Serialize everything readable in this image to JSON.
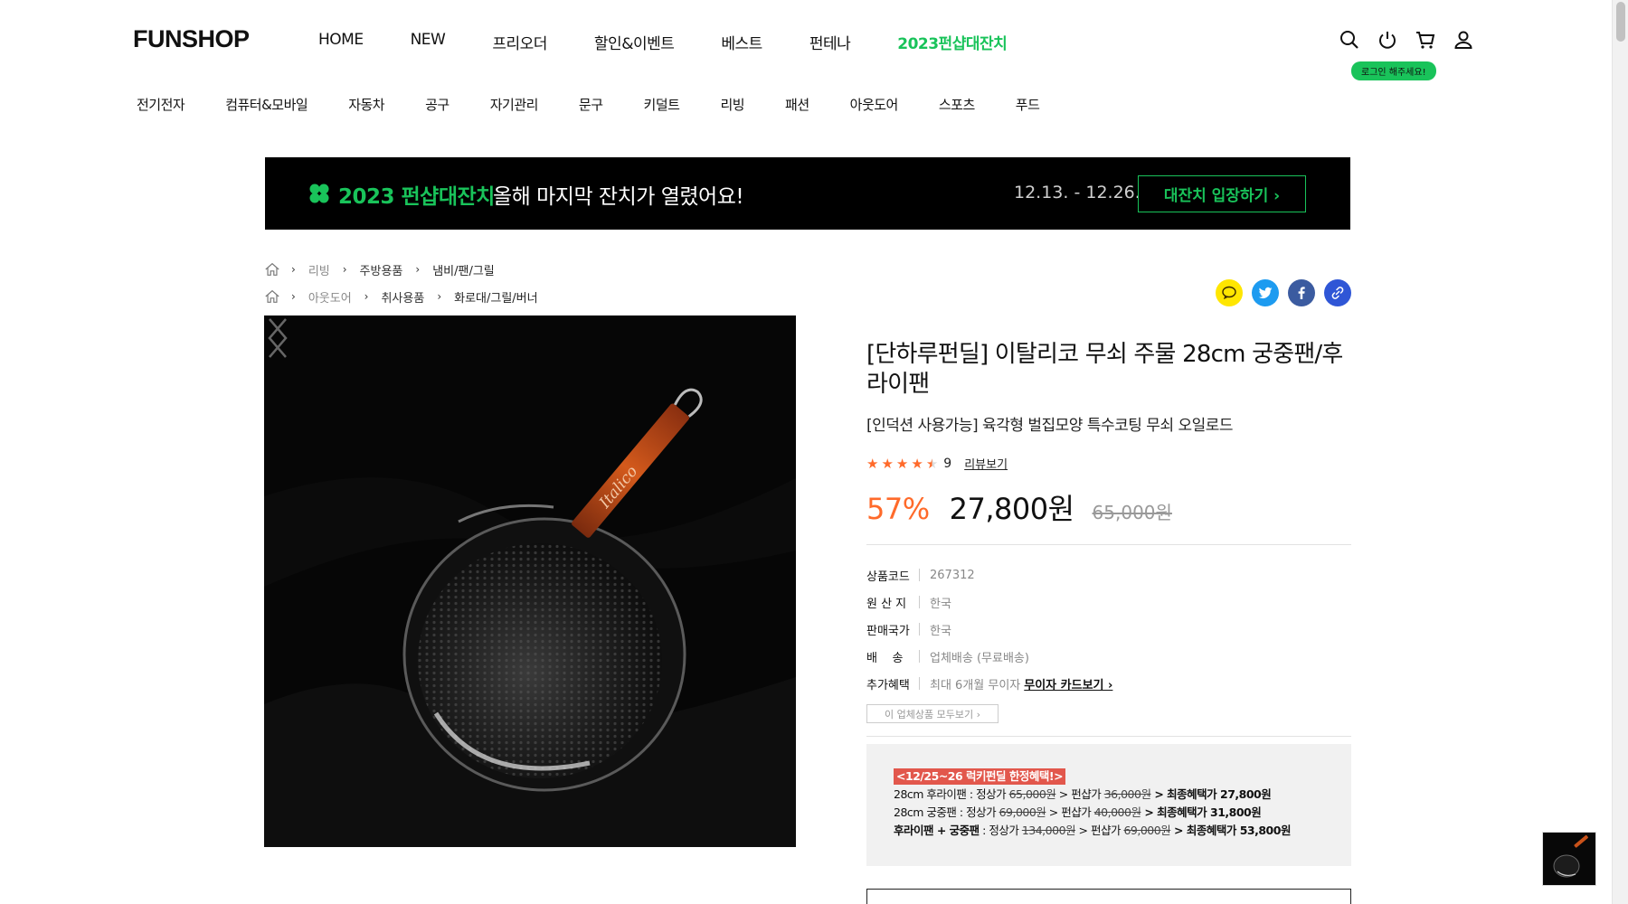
{
  "header": {
    "logo": "FUNSHOP",
    "nav": [
      "HOME",
      "NEW",
      "프리오더",
      "할인&이벤트",
      "베스트",
      "펀테나",
      "2023펀샵대잔치"
    ],
    "login_badge": "로그인 해주세요!"
  },
  "categories": [
    "전기전자",
    "컴퓨터&모바일",
    "자동차",
    "공구",
    "자기관리",
    "문구",
    "키덜트",
    "리빙",
    "패션",
    "아웃도어",
    "스포츠",
    "푸드"
  ],
  "banner": {
    "title": "2023 펀샵대잔치",
    "subtitle": "올해 마지막 잔치가 열렸어요!",
    "date": "12.13. - 12.26.",
    "cta": "대잔치 입장하기 ›"
  },
  "breadcrumbs": [
    [
      "리빙",
      "주방용품",
      "냄비/팬/그릴"
    ],
    [
      "아웃도어",
      "취사용품",
      "화로대/그릴/버너"
    ]
  ],
  "product": {
    "brand_on_handle": "Italico",
    "title": "[단하루펀딜] 이탈리코 무쇠 주물 28cm 궁중팬/후라이팬",
    "subtitle": "[인덕션 사용가능] 육각형 벌집모양 특수코팅 무쇠 오일로드",
    "rating": 4.5,
    "review_count": "9",
    "review_link": "리뷰보기",
    "discount": "57%",
    "price": "27,800원",
    "original_price": "65,000원",
    "specs": [
      {
        "key": "상품코드",
        "value": "267312"
      },
      {
        "key": "원 산 지",
        "value": "한국"
      },
      {
        "key": "판매국가",
        "value": "한국"
      },
      {
        "key": "배    송",
        "value": "업체배송 (무료배송)"
      },
      {
        "key": "추가혜택",
        "value": "최대 6개월 무이자",
        "link": "무이자 카드보기 ›"
      }
    ],
    "all_button": "이 업체상품 모두보기 ›",
    "benefit": {
      "tag": "<12/25~26 럭키펀딜 한정혜택!>",
      "lines": [
        {
          "prefix": "28cm 후라이팬 : 정상가 ",
          "list": "65,000원",
          "mid": " > 펀샵가 ",
          "shop": "36,000원",
          "final": " > 최종혜택가 27,800원",
          "bold_prefix": false
        },
        {
          "prefix": "28cm 궁중팬 : 정상가 ",
          "list": "69,000원",
          "mid": " > 펀샵가 ",
          "shop": "40,000원",
          "final": " > 최종혜택가 31,800원",
          "bold_prefix": false
        },
        {
          "prefix_bold": "후라이팬 + 궁중팬",
          "prefix": " : 정상가 ",
          "list": "134,000원",
          "mid": " > 펀샵가 ",
          "shop": "69,000원",
          "final": " > 최종혜택가 53,800원",
          "bold_prefix": true
        }
      ]
    }
  },
  "colors": {
    "accent_green": "#19c35a",
    "accent_orange": "#ff6a2a",
    "tag_red": "#e2574c",
    "banner_bg": "#000000"
  },
  "icons": [
    "search-icon",
    "power-icon",
    "cart-icon",
    "user-icon",
    "home-icon",
    "kakao-icon",
    "twitter-icon",
    "facebook-icon",
    "link-icon",
    "chevron-left-icon",
    "chevron-right-icon",
    "clover-icon",
    "star-icon"
  ]
}
